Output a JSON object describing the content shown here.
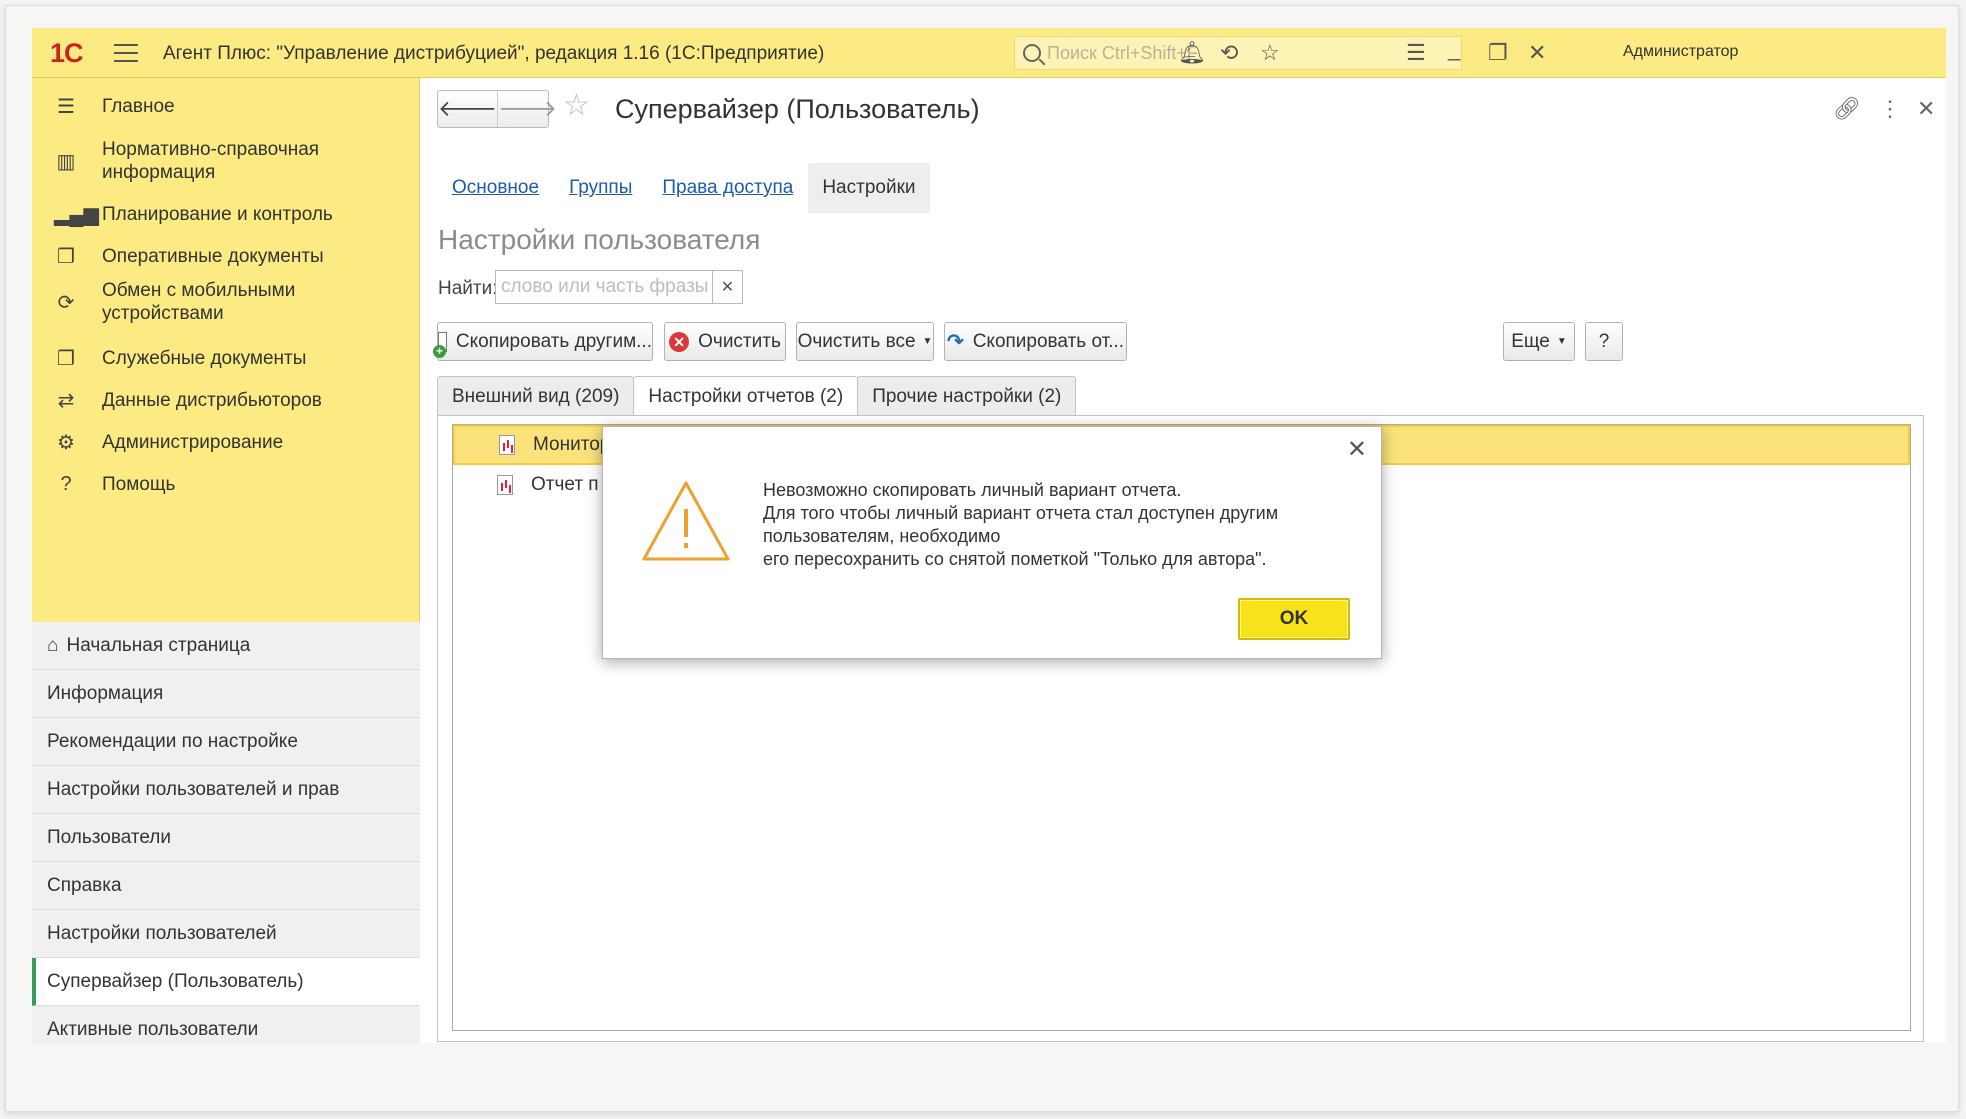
{
  "titlebar": {
    "logo": "1С",
    "title": "Агент Плюс: \"Управление дистрибуцией\", редакция 1.16  (1С:Предприятие)",
    "search_placeholder": "Поиск Ctrl+Shift+F",
    "user": "Администратор"
  },
  "sidebar": {
    "items": [
      {
        "label": "Главное",
        "icon": "hamburger-icon"
      },
      {
        "label": "Нормативно-справочная информация",
        "icon": "catalog-icon"
      },
      {
        "label": "Планирование и контроль",
        "icon": "chart-icon"
      },
      {
        "label": "Оперативные документы",
        "icon": "documents-icon"
      },
      {
        "label": "Обмен с мобильными устройствами",
        "icon": "sync-icon"
      },
      {
        "label": "Служебные документы",
        "icon": "service-docs-icon"
      },
      {
        "label": "Данные дистрибьюторов",
        "icon": "distributor-icon"
      },
      {
        "label": "Администрирование",
        "icon": "gear-icon"
      },
      {
        "label": "Помощь",
        "icon": "help-icon"
      }
    ],
    "open_windows": [
      {
        "label": "Начальная страница"
      },
      {
        "label": "Информация"
      },
      {
        "label": "Рекомендации по настройке"
      },
      {
        "label": "Настройки пользователей и прав"
      },
      {
        "label": "Пользователи"
      },
      {
        "label": "Справка"
      },
      {
        "label": "Настройки пользователей"
      },
      {
        "label": "Супервайзер (Пользователь)"
      },
      {
        "label": "Активные пользователи"
      }
    ]
  },
  "main": {
    "title": "Супервайзер (Пользователь)",
    "tabs": [
      {
        "label": "Основное"
      },
      {
        "label": "Группы"
      },
      {
        "label": "Права доступа"
      },
      {
        "label": "Настройки"
      }
    ],
    "section_title": "Настройки пользователя",
    "find_label": "Найти:",
    "find_placeholder": "слово или часть фразы",
    "buttons": {
      "copy_to_others": "Скопировать другим...",
      "clear": "Очистить",
      "clear_all": "Очистить все",
      "copy_from": "Скопировать от...",
      "more": "Еще",
      "help": "?"
    },
    "settings_tabs": [
      {
        "label": "Внешний вид (209)"
      },
      {
        "label": "Настройки отчетов (2)"
      },
      {
        "label": "Прочие настройки (2)"
      }
    ],
    "rows": [
      {
        "text": "Монитор супервайзера - копия"
      },
      {
        "text": "Отчет п"
      }
    ]
  },
  "dialog": {
    "lines": [
      "Невозможно скопировать личный вариант отчета.",
      "Для того чтобы личный вариант отчета стал доступен другим",
      "пользователям, необходимо",
      "его пересохранить со снятой пометкой \"Только для автора\"."
    ],
    "ok": "OK"
  },
  "colors": {
    "panel_yellow": "#fbeb82",
    "ok_yellow": "#f8e21a",
    "warning_orange": "#f0a030",
    "link_blue": "#1c5bad"
  }
}
